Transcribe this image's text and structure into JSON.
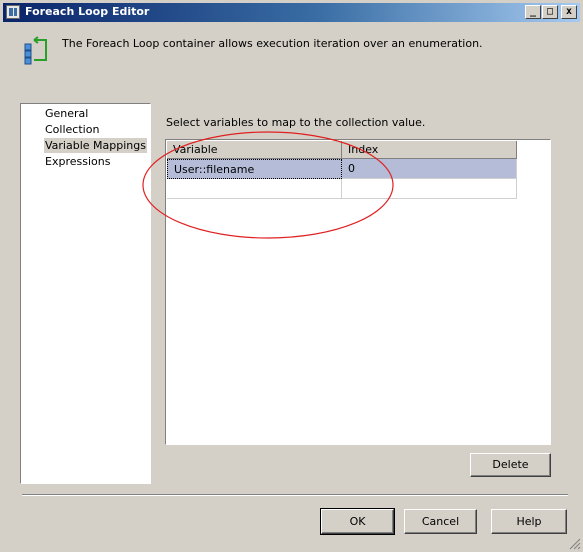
{
  "window": {
    "title": "Foreach Loop Editor",
    "controls": {
      "minimize": "_",
      "maximize": "□",
      "close": "x"
    }
  },
  "header": {
    "description": "The Foreach Loop container allows execution iteration over an enumeration.",
    "icon": "foreach-loop-icon"
  },
  "nav": {
    "items": [
      {
        "label": "General",
        "selected": false
      },
      {
        "label": "Collection",
        "selected": false
      },
      {
        "label": "Variable Mappings",
        "selected": true
      },
      {
        "label": "Expressions",
        "selected": false
      }
    ]
  },
  "mappings": {
    "instruction": "Select variables to map to the collection value.",
    "columns": [
      "Variable",
      "Index"
    ],
    "rows": [
      {
        "variable": "User::filename",
        "index": "0",
        "selected": true
      },
      {
        "variable": "",
        "index": "",
        "selected": false
      }
    ],
    "delete_label": "Delete"
  },
  "footer": {
    "ok_label": "OK",
    "cancel_label": "Cancel",
    "help_label": "Help"
  },
  "colors": {
    "titlebar_start": "#0a246a",
    "titlebar_end": "#a6caf0",
    "annotation_ellipse": "#e02020",
    "selection": "#b4bcd8"
  }
}
